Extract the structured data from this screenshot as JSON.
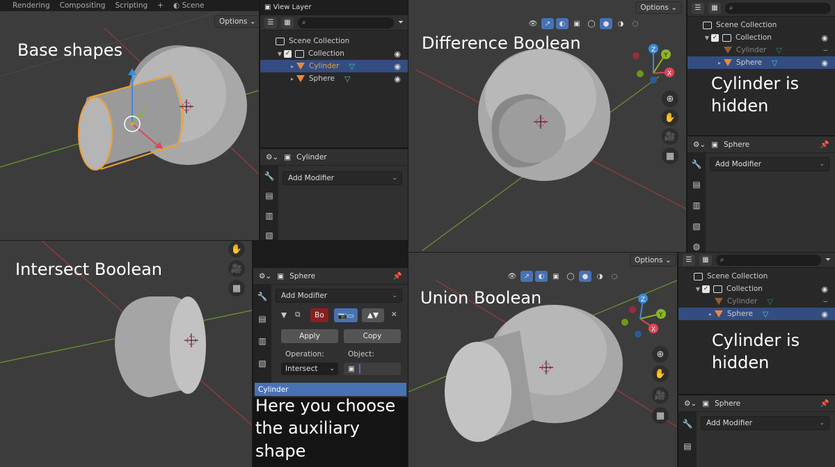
{
  "topbar": {
    "tabs": [
      "Rendering",
      "Compositing",
      "Scripting"
    ],
    "plus": "+",
    "scene": "Scene",
    "view_layer": "View Layer"
  },
  "options_label": "Options",
  "labels": {
    "base": "Base shapes",
    "difference": "Difference Boolean",
    "intersect": "Intersect Boolean",
    "union": "Union Boolean",
    "hidden1": "Cylinder is hidden",
    "hidden2": "Cylinder is hidden",
    "choose": "Here you choose the auxiliary shape"
  },
  "outliner": {
    "scene_collection": "Scene Collection",
    "collection": "Collection",
    "cylinder": "Cylinder",
    "sphere": "Sphere"
  },
  "props": {
    "cylinder_title": "Cylinder",
    "sphere_title": "Sphere",
    "add_modifier": "Add Modifier",
    "mod_name": "Bo",
    "apply": "Apply",
    "copy": "Copy",
    "operation_label": "Operation:",
    "object_label": "Object:",
    "operation_value": "Intersect",
    "dropdown_item": "Cylinder"
  },
  "gizmo": {
    "x": "X",
    "y": "Y",
    "z": "Z"
  },
  "colors": {
    "selected_row": "#334d80",
    "accent_blue": "#4772b3",
    "object_orange": "#e88a3c",
    "mesh_cyan": "#4fc7c2",
    "x_red": "#e0445a",
    "y_green": "#8ab624",
    "z_blue": "#3d8ad9"
  }
}
